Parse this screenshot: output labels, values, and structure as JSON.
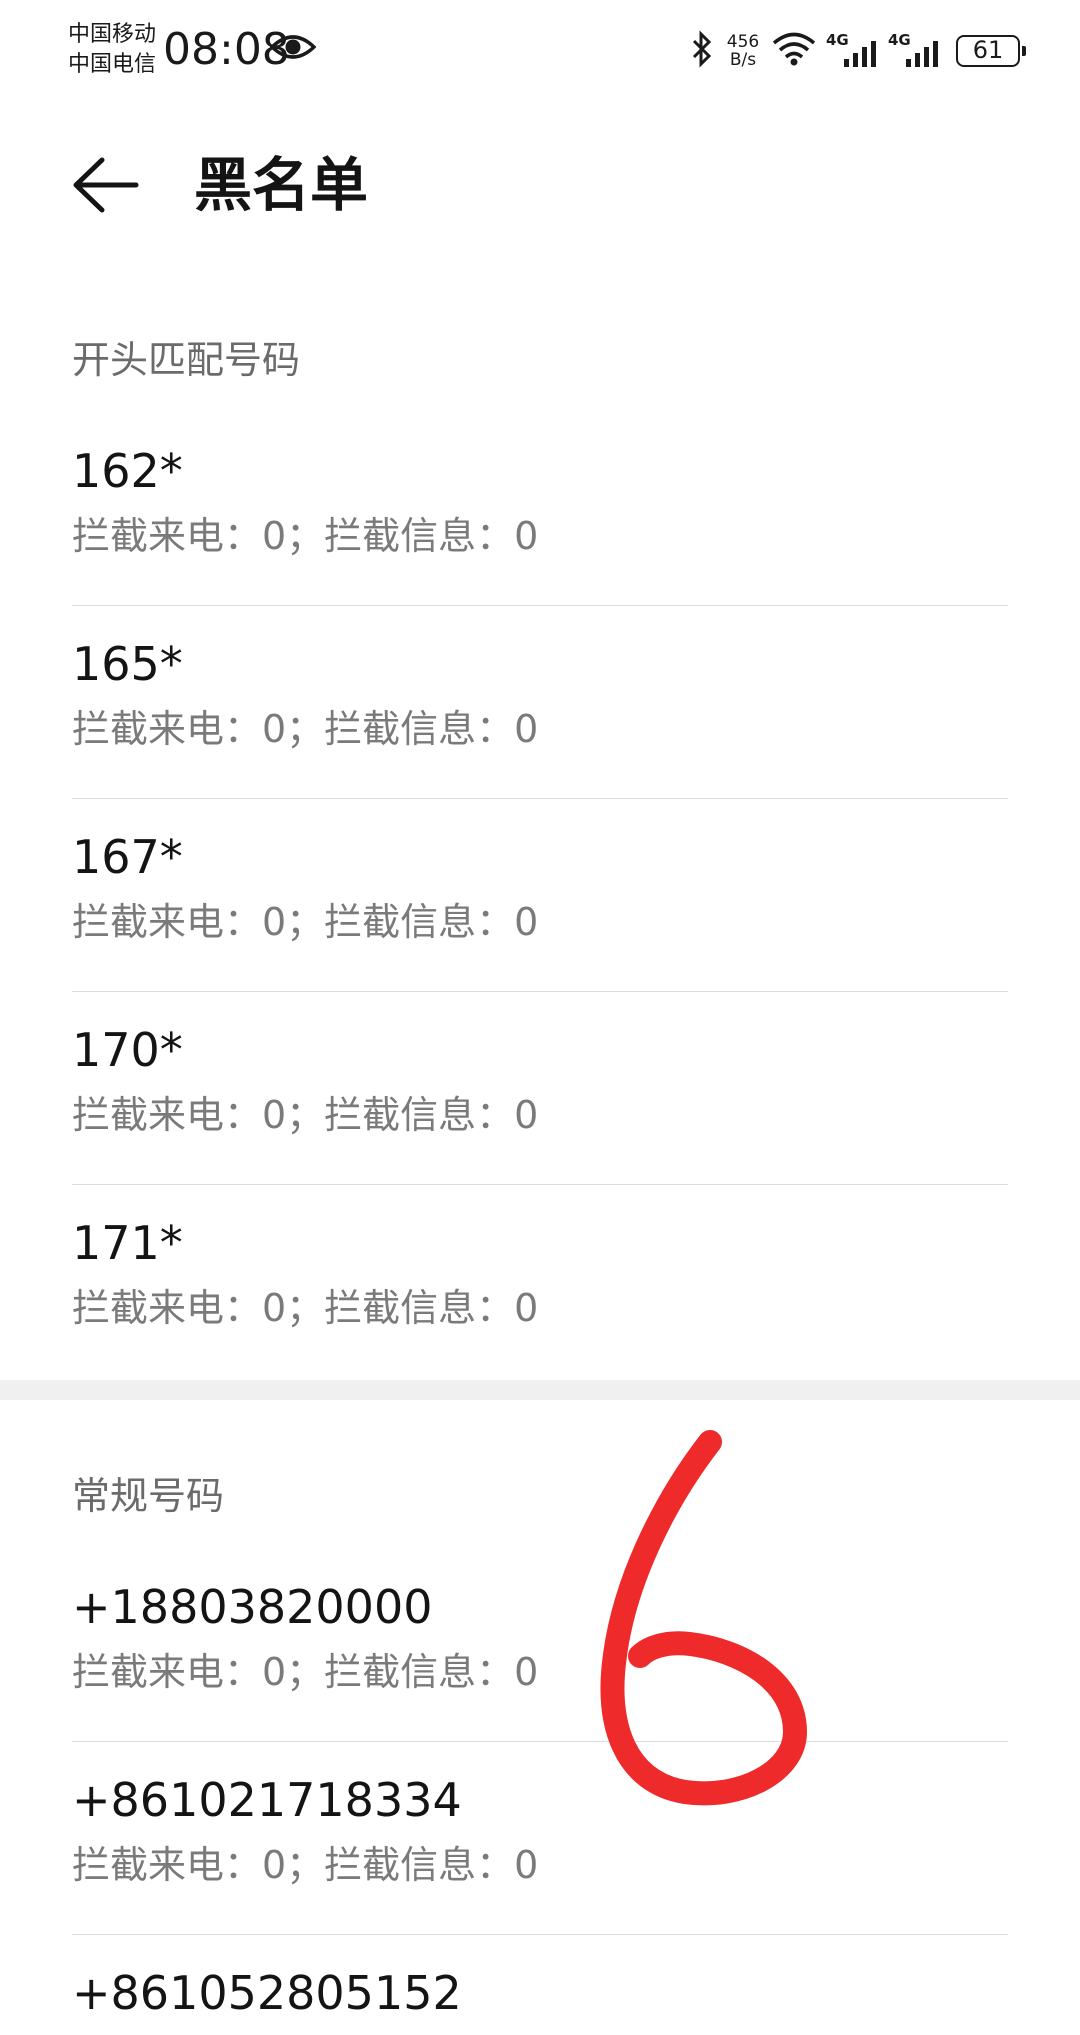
{
  "status_bar": {
    "carrier_1": "中国移动",
    "carrier_2": "中国电信",
    "time": "08:08",
    "speed_value": "456",
    "speed_unit": "B/s",
    "network_1": "4G",
    "network_2": "4G",
    "battery": "61",
    "icons": [
      "eye-icon",
      "bluetooth-icon",
      "wifi-icon",
      "signal-icon",
      "battery-icon"
    ]
  },
  "header": {
    "title": "黑名单",
    "back_icon": "arrow-left-icon"
  },
  "sections": {
    "prefix": {
      "title": "开头匹配号码",
      "items": [
        {
          "number": "162*",
          "stats": "拦截来电：0；拦截信息：0"
        },
        {
          "number": "165*",
          "stats": "拦截来电：0；拦截信息：0"
        },
        {
          "number": "167*",
          "stats": "拦截来电：0；拦截信息：0"
        },
        {
          "number": "170*",
          "stats": "拦截来电：0；拦截信息：0"
        },
        {
          "number": "171*",
          "stats": "拦截来电：0；拦截信息：0"
        }
      ]
    },
    "regular": {
      "title": "常规号码",
      "items": [
        {
          "number": "+18803820000",
          "stats": "拦截来电：0；拦截信息：0"
        },
        {
          "number": "+861021718334",
          "stats": "拦截来电：0；拦截信息：0"
        },
        {
          "number": "+861052805152",
          "stats": ""
        }
      ]
    }
  },
  "colors": {
    "background": "#ffffff",
    "primary_text": "#141414",
    "secondary_text": "#7a7a7a",
    "divider": "#dcdcdc",
    "annotation": "#ee2a2a"
  }
}
